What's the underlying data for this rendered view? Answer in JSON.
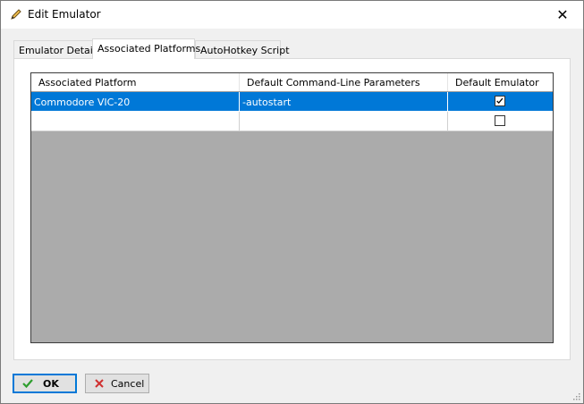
{
  "window": {
    "title": "Edit Emulator",
    "close_symbol": "✕"
  },
  "tabs": [
    {
      "label": "Emulator Details",
      "active": false
    },
    {
      "label": "Associated Platforms",
      "active": true
    },
    {
      "label": "AutoHotkey Script",
      "active": false
    }
  ],
  "grid": {
    "columns": [
      "Associated Platform",
      "Default Command-Line Parameters",
      "Default Emulator"
    ],
    "rows": [
      {
        "platform": "Commodore VIC-20",
        "params": "-autostart",
        "default": true,
        "selected": true
      },
      {
        "platform": "",
        "params": "",
        "default": false,
        "selected": false
      }
    ]
  },
  "buttons": {
    "ok_label": "OK",
    "cancel_label": "Cancel"
  },
  "colors": {
    "selection": "#0078d7",
    "grid_background": "#ababab",
    "ok_icon": "#2e9e2e",
    "cancel_icon": "#d03030"
  },
  "icons": {
    "title": "pencil-icon",
    "ok": "checkmark-icon",
    "cancel": "x-icon"
  }
}
